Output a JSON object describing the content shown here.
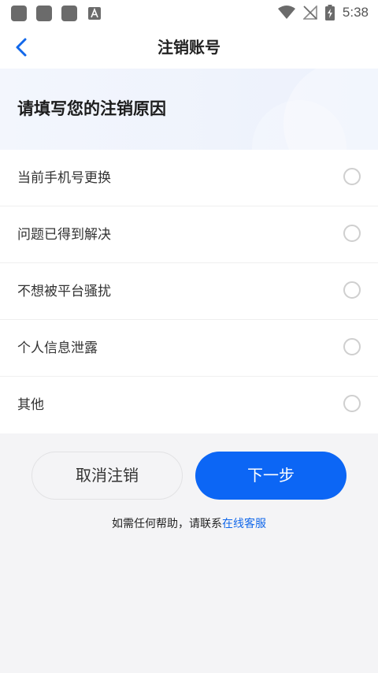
{
  "status_bar": {
    "time": "5:38",
    "icons": [
      "notification-square-icon",
      "notification-square-icon",
      "notification-square-icon",
      "a-app-icon",
      "wifi-icon",
      "no-signal-icon",
      "battery-charging-icon"
    ]
  },
  "header": {
    "title": "注销账号",
    "back_icon": "chevron-left-icon"
  },
  "banner": {
    "heading": "请填写您的注销原因"
  },
  "reasons": [
    {
      "label": "当前手机号更换",
      "selected": false
    },
    {
      "label": "问题已得到解决",
      "selected": false
    },
    {
      "label": "不想被平台骚扰",
      "selected": false
    },
    {
      "label": "个人信息泄露",
      "selected": false
    },
    {
      "label": "其他",
      "selected": false
    }
  ],
  "actions": {
    "cancel_label": "取消注销",
    "next_label": "下一步"
  },
  "help": {
    "text": "如需任何帮助，请联系",
    "link": "在线客服"
  },
  "colors": {
    "accent": "#0c66f5",
    "link": "#1268ea",
    "page_bg": "#f4f4f6"
  }
}
